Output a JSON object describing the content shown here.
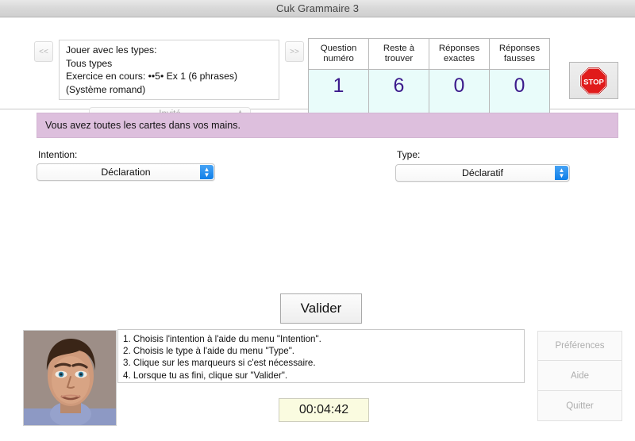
{
  "window": {
    "title": "Cuk Grammaire 3"
  },
  "nav": {
    "prev_label": "<<",
    "next_label": ">>"
  },
  "exercise": {
    "text": "Jouer avec les types:\nTous types\nExercice en cours: ••5• Ex 1 (6 phrases)\n(Système romand)"
  },
  "user": {
    "selected": "Invité",
    "stepper_icon": "stepper-icon"
  },
  "stats": {
    "columns": [
      {
        "header": "Question\nnuméro",
        "value": "1",
        "name": "question-number"
      },
      {
        "header": "Reste à\ntrouver",
        "value": "6",
        "name": "remaining"
      },
      {
        "header": "Réponses\nexactes",
        "value": "0",
        "name": "correct-answers"
      },
      {
        "header": "Réponses\nfausses",
        "value": "0",
        "name": "wrong-answers"
      }
    ],
    "value_color": "#3c1b8c",
    "cell_bg": "#e9fcfa"
  },
  "stop": {
    "label": "STOP",
    "icon": "stop-sign-icon",
    "color": "#e01b1b"
  },
  "message": {
    "text": "Vous avez toutes les cartes dans vos mains.",
    "bg": "#ddbfdd"
  },
  "selectors": {
    "intention": {
      "label": "Intention:",
      "value": "Déclaration"
    },
    "type": {
      "label": "Type:",
      "value": "Déclaratif"
    },
    "arrow_color": "#1f8ef1"
  },
  "validate": {
    "label": "Valider"
  },
  "avatar": {
    "name": "tutor-avatar"
  },
  "instructions": {
    "text": "1. Choisis l'intention à l'aide du menu \"Intention\".\n2. Choisis le type à l'aide du menu \"Type\".\n3. Clique sur les marqueurs si c'est nécessaire.\n4. Lorsque tu as fini, clique sur \"Valider\"."
  },
  "timer": {
    "value": "00:04:42",
    "bg": "#fafbe0"
  },
  "side_buttons": [
    {
      "label": "Préférences",
      "name": "preferences-button"
    },
    {
      "label": "Aide",
      "name": "help-button"
    },
    {
      "label": "Quitter",
      "name": "quit-button"
    }
  ]
}
